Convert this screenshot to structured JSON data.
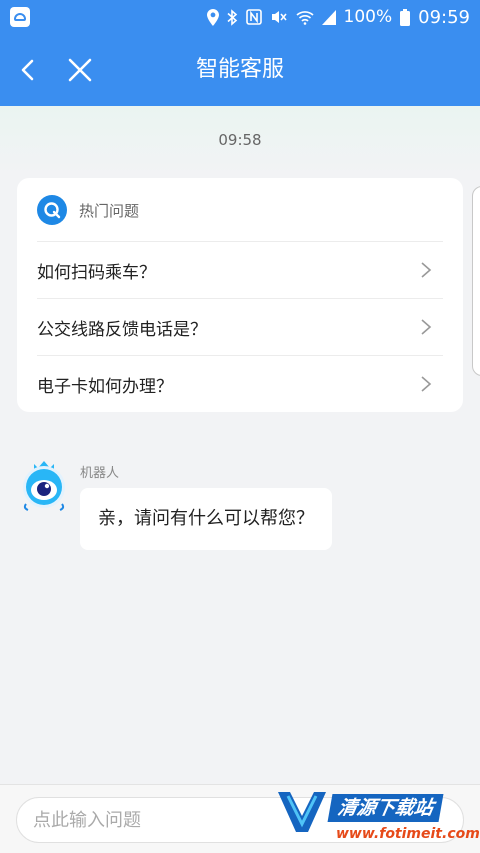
{
  "status_bar": {
    "battery": "100%",
    "time": "09:59",
    "icons": [
      "app-icon",
      "location-icon",
      "bluetooth-icon",
      "nfc-icon",
      "mute-icon",
      "wifi-icon",
      "signal-icon"
    ]
  },
  "header": {
    "title": "智能客服",
    "back_icon": "chevron-left-icon",
    "close_icon": "close-icon",
    "background": "#3a8ef0"
  },
  "chat": {
    "timestamp": "09:58",
    "hot_card": {
      "title": "热门问题",
      "icon": "hot-questions-icon",
      "questions": [
        {
          "text": "如何扫码乘车？"
        },
        {
          "text": "公交线路反馈电话是？"
        },
        {
          "text": "电子卡如何办理？"
        }
      ]
    },
    "bot": {
      "name": "机器人",
      "message": "亲，请问有什么可以帮您？",
      "avatar": "robot-avatar-icon"
    }
  },
  "input": {
    "placeholder": "点此输入问题",
    "value": ""
  },
  "watermark": {
    "brand": "清源下载站",
    "url": "www.fotimeit.com"
  },
  "colors": {
    "primary": "#3a8ef0",
    "hot_icon": "#1e88e5",
    "watermark_url": "#e64a19"
  }
}
